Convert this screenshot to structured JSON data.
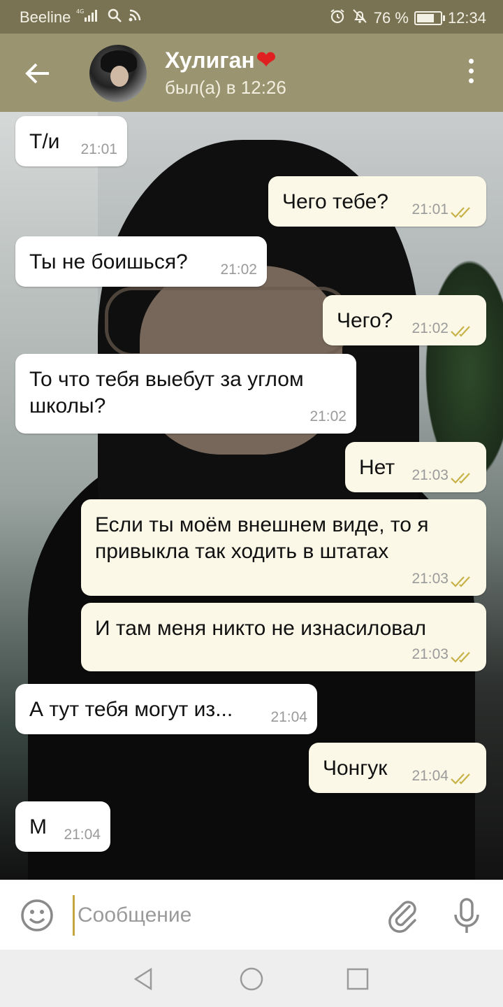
{
  "status_bar": {
    "carrier": "Beeline",
    "network": "4G",
    "battery_percent": "76 %",
    "battery_level": 0.76,
    "time": "12:34"
  },
  "header": {
    "title": "Хулиган",
    "title_emoji": "❤",
    "subtitle": "был(а) в 12:26"
  },
  "messages": [
    {
      "dir": "in",
      "text": "Т/и",
      "time": "21:01"
    },
    {
      "dir": "out",
      "text": "Чего тебе?",
      "time": "21:01"
    },
    {
      "dir": "in",
      "text": "Ты не боишься?",
      "time": "21:02"
    },
    {
      "dir": "out",
      "text": "Чего?",
      "time": "21:02"
    },
    {
      "dir": "in",
      "text_lines": [
        "То что тебя выебут за углом",
        "школы?"
      ],
      "time": "21:02"
    },
    {
      "dir": "out",
      "text": "Нет",
      "time": "21:03"
    },
    {
      "dir": "out",
      "text_lines": [
        "Если ты моём внешнем виде, то я",
        "привыкла так ходить в штатах"
      ],
      "time": "21:03"
    },
    {
      "dir": "out",
      "text": "И там меня никто не изнасиловал",
      "time": "21:03"
    },
    {
      "dir": "in",
      "text": "А тут тебя могут из...",
      "time": "21:04"
    },
    {
      "dir": "out",
      "text": "Чонгук",
      "time": "21:04"
    },
    {
      "dir": "in",
      "text": "М",
      "time": "21:04"
    }
  ],
  "input": {
    "placeholder": "Сообщение"
  },
  "colors": {
    "status_bar": "#7a7353",
    "header": "#9b9470",
    "incoming_bubble": "#ffffff",
    "outgoing_bubble": "#fbf8e7",
    "read_ticks": "#c8b24a"
  }
}
